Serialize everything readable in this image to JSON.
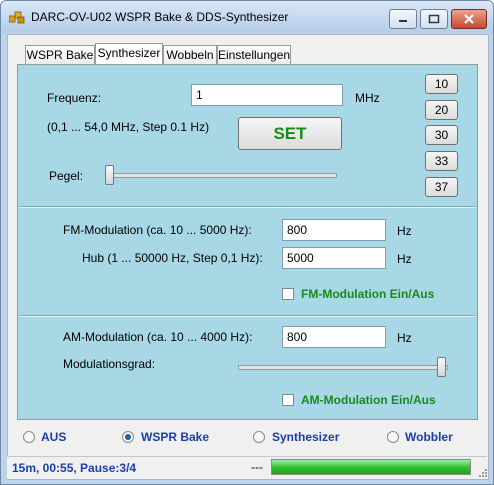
{
  "window": {
    "title": "DARC-OV-U02 WSPR Bake & DDS-Synthesizer"
  },
  "tabs": [
    {
      "label": "WSPR Bake"
    },
    {
      "label": "Synthesizer"
    },
    {
      "label": "Wobbeln"
    },
    {
      "label": "Einstellungen"
    }
  ],
  "active_tab": "Synthesizer",
  "synth": {
    "freq_label": "Frequenz:",
    "freq_value": "1",
    "freq_unit": "MHz",
    "range_hint": "(0,1 ... 54,0 MHz,   Step 0.1 Hz)",
    "set_button": "SET",
    "preset_buttons": [
      "10",
      "20",
      "30",
      "33",
      "37"
    ],
    "pegel_label": "Pegel:",
    "pegel_level": 0.0
  },
  "fm": {
    "mod_label": "FM-Modulation (ca. 10 ... 5000 Hz):",
    "mod_value": "800",
    "mod_unit": "Hz",
    "hub_label": "Hub (1 ... 50000 Hz, Step 0,1 Hz):",
    "hub_value": "5000",
    "hub_unit": "Hz",
    "enable_label": "FM-Modulation Ein/Aus",
    "enable_checked": false
  },
  "am": {
    "mod_label": "AM-Modulation (ca. 10 ... 4000 Hz):",
    "mod_value": "800",
    "mod_unit": "Hz",
    "grad_label": "Modulationsgrad:",
    "grad_level": 1.0,
    "enable_label": "AM-Modulation Ein/Aus",
    "enable_checked": false
  },
  "modes": [
    {
      "label": "AUS",
      "selected": false
    },
    {
      "label": "WSPR Bake",
      "selected": true
    },
    {
      "label": "Synthesizer",
      "selected": false
    },
    {
      "label": "Wobbler",
      "selected": false
    }
  ],
  "status": {
    "text": "15m, 00:55, Pause:3/4",
    "dashes": "---",
    "progress": 1.0
  },
  "colors": {
    "panel_bg": "#a8d8e6",
    "accent_green": "#1a8a1a",
    "status_blue": "#1a3fa8"
  }
}
